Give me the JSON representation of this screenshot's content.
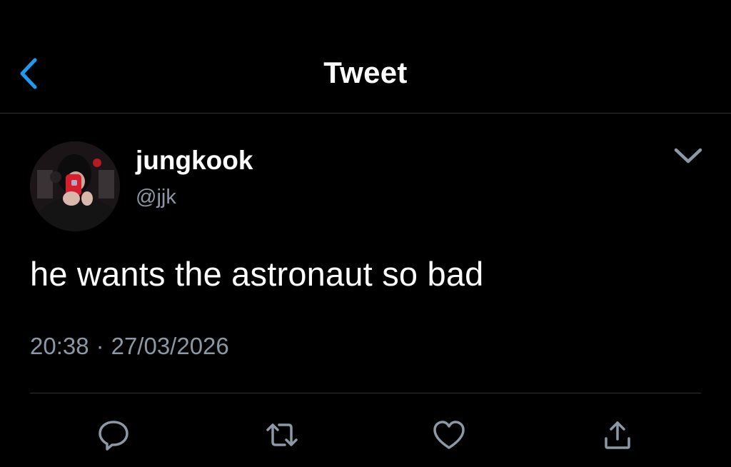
{
  "header": {
    "title": "Tweet",
    "back_icon": "chevron-left-icon",
    "accent_color": "#1d9bf0"
  },
  "tweet": {
    "author_name": "jungkook",
    "author_handle": "@jjk",
    "text": "he wants the astronaut so bad",
    "time": "20:38",
    "separator": "·",
    "date": "27/03/2026",
    "more_icon": "chevron-down-icon"
  },
  "actions": [
    {
      "name": "reply",
      "icon": "speech-bubble-icon"
    },
    {
      "name": "retweet",
      "icon": "retweet-icon"
    },
    {
      "name": "like",
      "icon": "heart-icon"
    },
    {
      "name": "share",
      "icon": "share-icon"
    }
  ],
  "colors": {
    "background": "#000000",
    "text": "#ffffff",
    "secondary_text": "#8b98a5",
    "divider": "#2f3336"
  }
}
